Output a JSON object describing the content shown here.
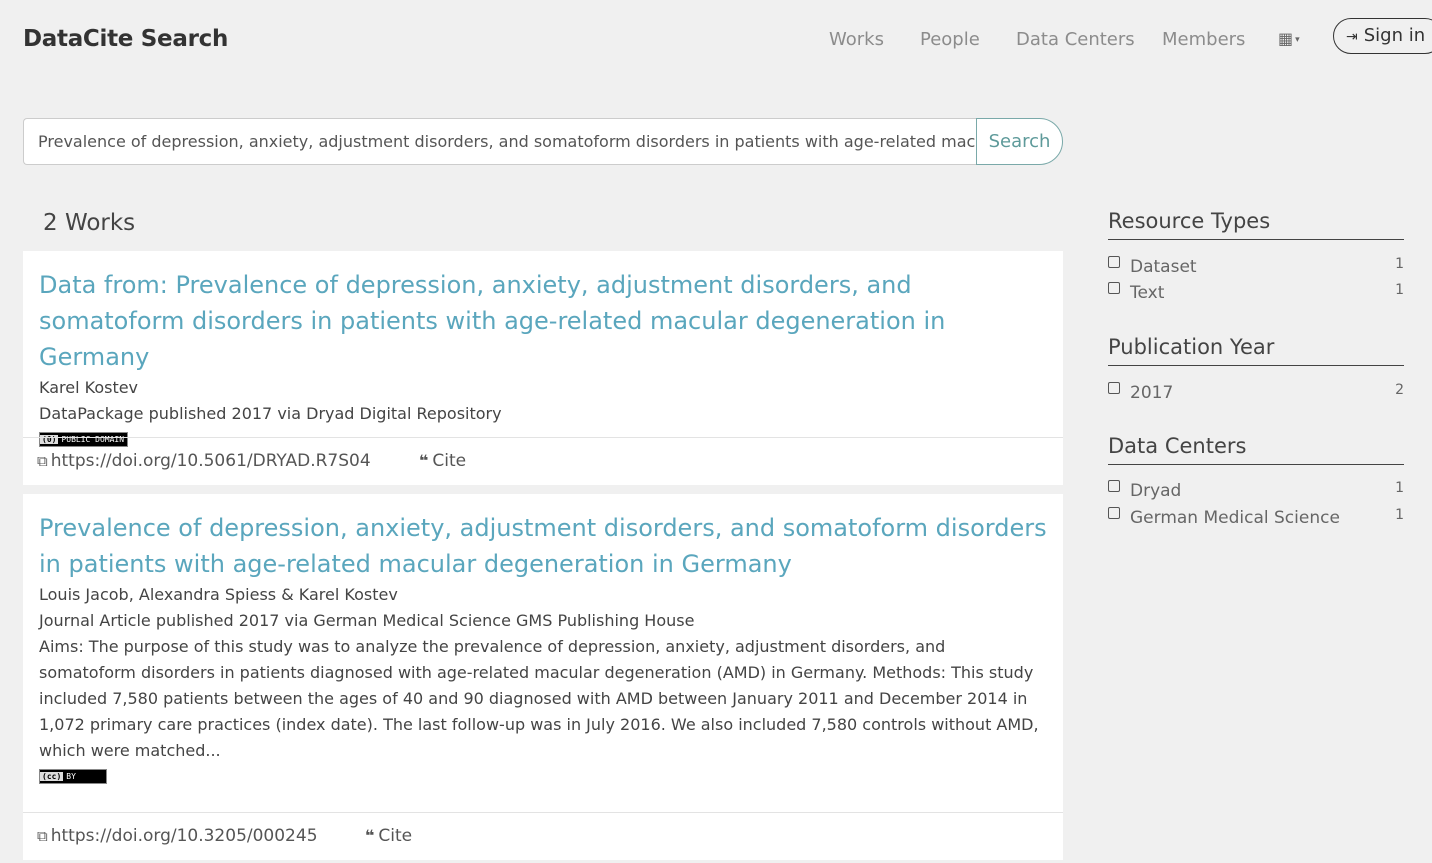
{
  "header": {
    "brand": "DataCite Search",
    "nav": [
      "Works",
      "People",
      "Data Centers",
      "Members"
    ],
    "apps_icon": "grid-icon",
    "signin_label": "Sign in",
    "signin_icon": "sign-in-icon"
  },
  "search": {
    "value": "Prevalence of depression, anxiety, adjustment disorders, and somatoform disorders in patients with age-related macular degeneration in Germany",
    "button_label": "Search"
  },
  "results": {
    "count_label": "2 Works",
    "items": [
      {
        "title": "Data from: Prevalence of depression, anxiety, adjustment disorders, and somatoform disorders in patients with age-related macular degeneration in Germany",
        "authors": "Karel Kostev",
        "published": "DataPackage published 2017 via Dryad Digital Repository",
        "description": "",
        "license_badge": "PUBLIC DOMAIN",
        "doi": "https://doi.org/10.5061/DRYAD.R7S04",
        "cite_label": "Cite"
      },
      {
        "title": "Prevalence of depression, anxiety, adjustment disorders, and somatoform disorders in patients with age-related macular degeneration in Germany",
        "authors": "Louis Jacob, Alexandra Spiess & Karel Kostev",
        "published": "Journal Article published 2017 via German Medical Science GMS Publishing House",
        "description": "Aims: The purpose of this study was to analyze the prevalence of depression, anxiety, adjustment disorders, and somatoform disorders in patients diagnosed with age-related macular degeneration (AMD) in Germany. Methods: This study included 7,580 patients between the ages of 40 and 90 diagnosed with AMD between January 2011 and December 2014 in 1,072 primary care practices (index date). The last follow-up was in July 2016. We also included 7,580 controls without AMD, which were matched...",
        "license_badge": "BY",
        "doi": "https://doi.org/10.3205/000245",
        "cite_label": "Cite"
      }
    ]
  },
  "facets": {
    "resource_types": {
      "title": "Resource Types",
      "items": [
        {
          "label": "Dataset",
          "count": "1"
        },
        {
          "label": "Text",
          "count": "1"
        }
      ]
    },
    "publication_year": {
      "title": "Publication Year",
      "items": [
        {
          "label": "2017",
          "count": "2"
        }
      ]
    },
    "data_centers": {
      "title": "Data Centers",
      "items": [
        {
          "label": "Dryad",
          "count": "1"
        },
        {
          "label": "German Medical Science",
          "count": "1"
        }
      ]
    }
  },
  "colors": {
    "title_link": "#5aa6bd",
    "search_button": "#5e9a9a",
    "background": "#f0f0f0"
  }
}
